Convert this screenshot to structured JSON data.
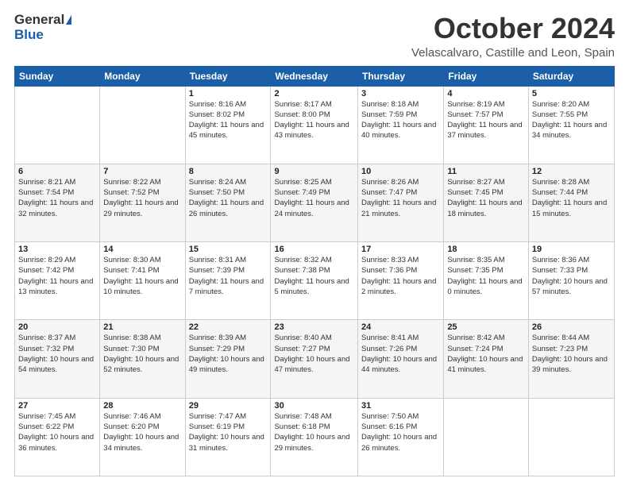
{
  "logo": {
    "general": "General",
    "blue": "Blue"
  },
  "title": {
    "month": "October 2024",
    "location": "Velascalvaro, Castille and Leon, Spain"
  },
  "headers": [
    "Sunday",
    "Monday",
    "Tuesday",
    "Wednesday",
    "Thursday",
    "Friday",
    "Saturday"
  ],
  "weeks": [
    [
      {
        "day": "",
        "info": ""
      },
      {
        "day": "",
        "info": ""
      },
      {
        "day": "1",
        "info": "Sunrise: 8:16 AM\nSunset: 8:02 PM\nDaylight: 11 hours and 45 minutes."
      },
      {
        "day": "2",
        "info": "Sunrise: 8:17 AM\nSunset: 8:00 PM\nDaylight: 11 hours and 43 minutes."
      },
      {
        "day": "3",
        "info": "Sunrise: 8:18 AM\nSunset: 7:59 PM\nDaylight: 11 hours and 40 minutes."
      },
      {
        "day": "4",
        "info": "Sunrise: 8:19 AM\nSunset: 7:57 PM\nDaylight: 11 hours and 37 minutes."
      },
      {
        "day": "5",
        "info": "Sunrise: 8:20 AM\nSunset: 7:55 PM\nDaylight: 11 hours and 34 minutes."
      }
    ],
    [
      {
        "day": "6",
        "info": "Sunrise: 8:21 AM\nSunset: 7:54 PM\nDaylight: 11 hours and 32 minutes."
      },
      {
        "day": "7",
        "info": "Sunrise: 8:22 AM\nSunset: 7:52 PM\nDaylight: 11 hours and 29 minutes."
      },
      {
        "day": "8",
        "info": "Sunrise: 8:24 AM\nSunset: 7:50 PM\nDaylight: 11 hours and 26 minutes."
      },
      {
        "day": "9",
        "info": "Sunrise: 8:25 AM\nSunset: 7:49 PM\nDaylight: 11 hours and 24 minutes."
      },
      {
        "day": "10",
        "info": "Sunrise: 8:26 AM\nSunset: 7:47 PM\nDaylight: 11 hours and 21 minutes."
      },
      {
        "day": "11",
        "info": "Sunrise: 8:27 AM\nSunset: 7:45 PM\nDaylight: 11 hours and 18 minutes."
      },
      {
        "day": "12",
        "info": "Sunrise: 8:28 AM\nSunset: 7:44 PM\nDaylight: 11 hours and 15 minutes."
      }
    ],
    [
      {
        "day": "13",
        "info": "Sunrise: 8:29 AM\nSunset: 7:42 PM\nDaylight: 11 hours and 13 minutes."
      },
      {
        "day": "14",
        "info": "Sunrise: 8:30 AM\nSunset: 7:41 PM\nDaylight: 11 hours and 10 minutes."
      },
      {
        "day": "15",
        "info": "Sunrise: 8:31 AM\nSunset: 7:39 PM\nDaylight: 11 hours and 7 minutes."
      },
      {
        "day": "16",
        "info": "Sunrise: 8:32 AM\nSunset: 7:38 PM\nDaylight: 11 hours and 5 minutes."
      },
      {
        "day": "17",
        "info": "Sunrise: 8:33 AM\nSunset: 7:36 PM\nDaylight: 11 hours and 2 minutes."
      },
      {
        "day": "18",
        "info": "Sunrise: 8:35 AM\nSunset: 7:35 PM\nDaylight: 11 hours and 0 minutes."
      },
      {
        "day": "19",
        "info": "Sunrise: 8:36 AM\nSunset: 7:33 PM\nDaylight: 10 hours and 57 minutes."
      }
    ],
    [
      {
        "day": "20",
        "info": "Sunrise: 8:37 AM\nSunset: 7:32 PM\nDaylight: 10 hours and 54 minutes."
      },
      {
        "day": "21",
        "info": "Sunrise: 8:38 AM\nSunset: 7:30 PM\nDaylight: 10 hours and 52 minutes."
      },
      {
        "day": "22",
        "info": "Sunrise: 8:39 AM\nSunset: 7:29 PM\nDaylight: 10 hours and 49 minutes."
      },
      {
        "day": "23",
        "info": "Sunrise: 8:40 AM\nSunset: 7:27 PM\nDaylight: 10 hours and 47 minutes."
      },
      {
        "day": "24",
        "info": "Sunrise: 8:41 AM\nSunset: 7:26 PM\nDaylight: 10 hours and 44 minutes."
      },
      {
        "day": "25",
        "info": "Sunrise: 8:42 AM\nSunset: 7:24 PM\nDaylight: 10 hours and 41 minutes."
      },
      {
        "day": "26",
        "info": "Sunrise: 8:44 AM\nSunset: 7:23 PM\nDaylight: 10 hours and 39 minutes."
      }
    ],
    [
      {
        "day": "27",
        "info": "Sunrise: 7:45 AM\nSunset: 6:22 PM\nDaylight: 10 hours and 36 minutes."
      },
      {
        "day": "28",
        "info": "Sunrise: 7:46 AM\nSunset: 6:20 PM\nDaylight: 10 hours and 34 minutes."
      },
      {
        "day": "29",
        "info": "Sunrise: 7:47 AM\nSunset: 6:19 PM\nDaylight: 10 hours and 31 minutes."
      },
      {
        "day": "30",
        "info": "Sunrise: 7:48 AM\nSunset: 6:18 PM\nDaylight: 10 hours and 29 minutes."
      },
      {
        "day": "31",
        "info": "Sunrise: 7:50 AM\nSunset: 6:16 PM\nDaylight: 10 hours and 26 minutes."
      },
      {
        "day": "",
        "info": ""
      },
      {
        "day": "",
        "info": ""
      }
    ]
  ]
}
